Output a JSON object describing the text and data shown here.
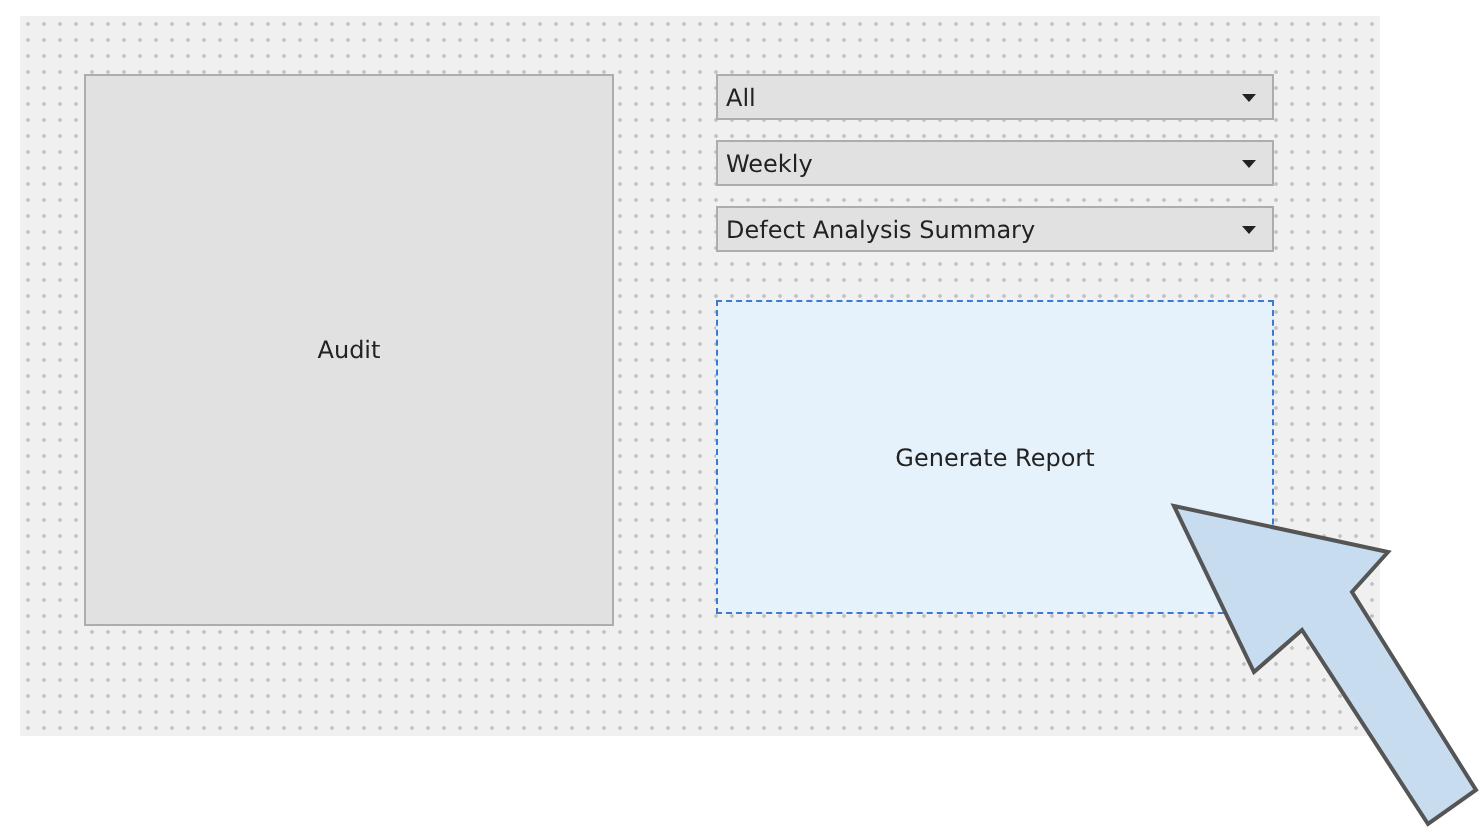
{
  "form": {
    "left_button": {
      "label": "Audit",
      "selected": false
    },
    "dropdowns": [
      {
        "value": "All"
      },
      {
        "value": "Weekly"
      },
      {
        "value": "Defect Analysis Summary"
      }
    ],
    "action_button": {
      "label": "Generate Report",
      "selected": true
    }
  }
}
